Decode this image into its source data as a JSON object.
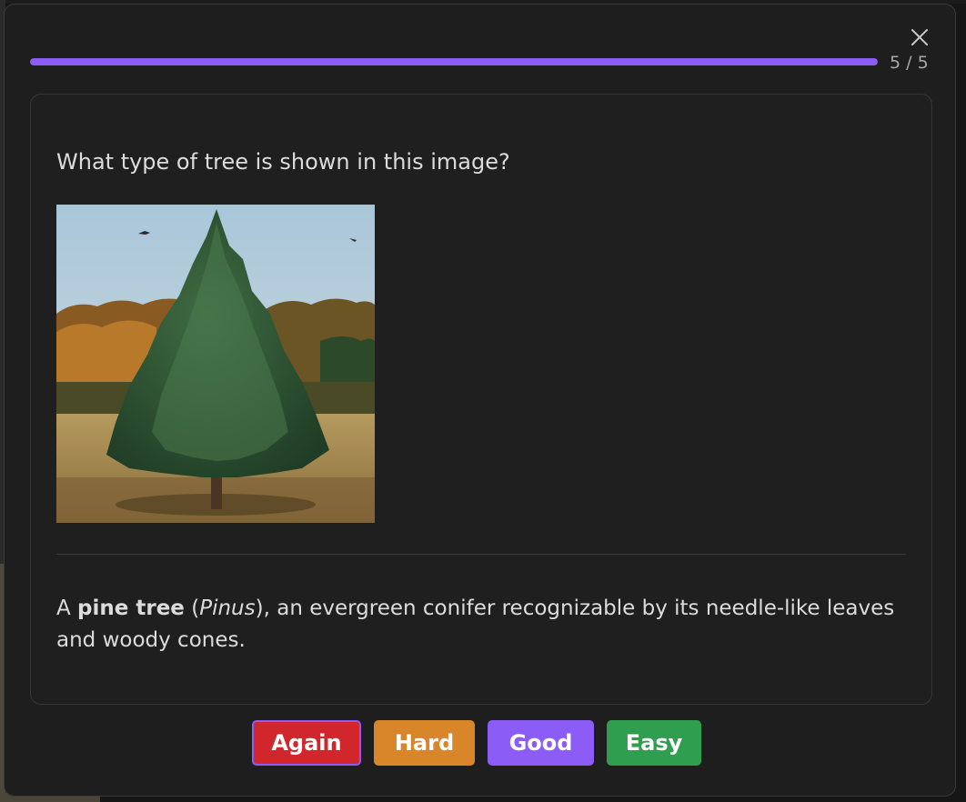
{
  "progress": {
    "text": "5 / 5",
    "fraction": 1.0,
    "fill_color": "#8b5cf6"
  },
  "close_icon": "close-icon",
  "card": {
    "question": "What type of tree is shown in this image?",
    "answer": {
      "prefix": "A ",
      "bold": "pine tree",
      "open_paren": " (",
      "italic": "Pinus",
      "rest": "), an evergreen conifer recognizable by its needle-like leaves and woody cones."
    }
  },
  "buttons": {
    "again": "Again",
    "hard": "Hard",
    "good": "Good",
    "easy": "Easy"
  },
  "colors": {
    "again": "#d0262c",
    "hard": "#d9852a",
    "good": "#8b5cf6",
    "easy": "#2f9e4f"
  }
}
